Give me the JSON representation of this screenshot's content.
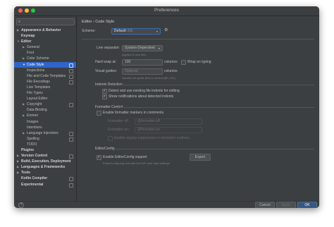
{
  "window": {
    "title": "Preferences"
  },
  "search": {
    "placeholder": "",
    "icon": "search-icon"
  },
  "sidebar": {
    "items": [
      {
        "label": "Appearance & Behavior",
        "level": 0,
        "arrow": "▶",
        "bold": true
      },
      {
        "label": "Keymap",
        "level": 0,
        "arrow": "",
        "bold": true
      },
      {
        "label": "Editor",
        "level": 0,
        "arrow": "▼",
        "bold": true
      },
      {
        "label": "General",
        "level": 1,
        "arrow": "▶"
      },
      {
        "label": "Font",
        "level": 1,
        "arrow": ""
      },
      {
        "label": "Color Scheme",
        "level": 1,
        "arrow": "▶"
      },
      {
        "label": "Code Style",
        "level": 1,
        "arrow": "▼",
        "selected": true,
        "cfg": true
      },
      {
        "label": "Inspections",
        "level": 1,
        "arrow": "",
        "cfg": true
      },
      {
        "label": "File and Code Templates",
        "level": 1,
        "arrow": "",
        "cfg": true
      },
      {
        "label": "File Encodings",
        "level": 1,
        "arrow": "",
        "cfg": true
      },
      {
        "label": "Live Templates",
        "level": 1,
        "arrow": ""
      },
      {
        "label": "File Types",
        "level": 1,
        "arrow": ""
      },
      {
        "label": "Layout Editor",
        "level": 1,
        "arrow": ""
      },
      {
        "label": "Copyright",
        "level": 1,
        "arrow": "▶",
        "cfg": true
      },
      {
        "label": "Data Binding",
        "level": 1,
        "arrow": ""
      },
      {
        "label": "Emmet",
        "level": 1,
        "arrow": "▶"
      },
      {
        "label": "Images",
        "level": 1,
        "arrow": ""
      },
      {
        "label": "Intentions",
        "level": 1,
        "arrow": ""
      },
      {
        "label": "Language Injections",
        "level": 1,
        "arrow": "▶",
        "cfg": true
      },
      {
        "label": "Spelling",
        "level": 1,
        "arrow": "",
        "cfg": true
      },
      {
        "label": "TODO",
        "level": 1,
        "arrow": ""
      },
      {
        "label": "Plugins",
        "level": 0,
        "arrow": "",
        "bold": true
      },
      {
        "label": "Version Control",
        "level": 0,
        "arrow": "▶",
        "bold": true,
        "cfg": true
      },
      {
        "label": "Build, Execution, Deployment",
        "level": 0,
        "arrow": "▶",
        "bold": true
      },
      {
        "label": "Languages & Frameworks",
        "level": 0,
        "arrow": "▶",
        "bold": true
      },
      {
        "label": "Tools",
        "level": 0,
        "arrow": "▶",
        "bold": true
      },
      {
        "label": "Kotlin Compiler",
        "level": 0,
        "arrow": "",
        "bold": true,
        "cfg": true
      },
      {
        "label": "Experimental",
        "level": 0,
        "arrow": "",
        "bold": true,
        "cfg": true
      }
    ]
  },
  "main": {
    "breadcrumb": {
      "parent": "Editor",
      "sep": "›",
      "current": "Code Style"
    },
    "scheme": {
      "label": "Scheme:",
      "value": "Default",
      "scope": "IDE",
      "gear_icon": "gear-icon"
    },
    "line_separator": {
      "label": "Line separator:",
      "value": "System-Dependent",
      "hint": "Applied to new files"
    },
    "hard_wrap": {
      "label": "Hard wrap at:",
      "value": "100",
      "unit": "columns",
      "wrap_on_typing_label": "Wrap on typing",
      "wrap_on_typing_checked": false
    },
    "visual_guides": {
      "label": "Visual guides:",
      "placeholder": "Optional",
      "unit": "columns",
      "hint": "Specify one guide (80) or several (80, 120)"
    },
    "indents_detection": {
      "title": "Indents Detection",
      "detect_label": "Detect and use existing file indents for editing",
      "detect_checked": true,
      "notify_label": "Show notifications about detected indents",
      "notify_checked": true
    },
    "formatter_control": {
      "title": "Formatter Control",
      "enable_label": "Enable formatter markers in comments",
      "enable_checked": false,
      "off_label": "Formatter off:",
      "off_value": "@formatter:off",
      "on_label": "Formatter on:",
      "on_value": "@formatter:on",
      "regex_label": "Enable regular expressions in formatter markers"
    },
    "editorconfig": {
      "title": "EditorConfig",
      "enable_label": "Enable EditorConfig support",
      "enable_checked": true,
      "export_label": "Export",
      "hint": "EditorConfig may override the IDE code style settings"
    }
  },
  "footer": {
    "help": "?",
    "cancel": "Cancel",
    "apply": "Apply",
    "ok": "OK"
  },
  "colors": {
    "accent": "#2f65ca",
    "background": "#3c3f41",
    "primary_button": "#365880"
  }
}
